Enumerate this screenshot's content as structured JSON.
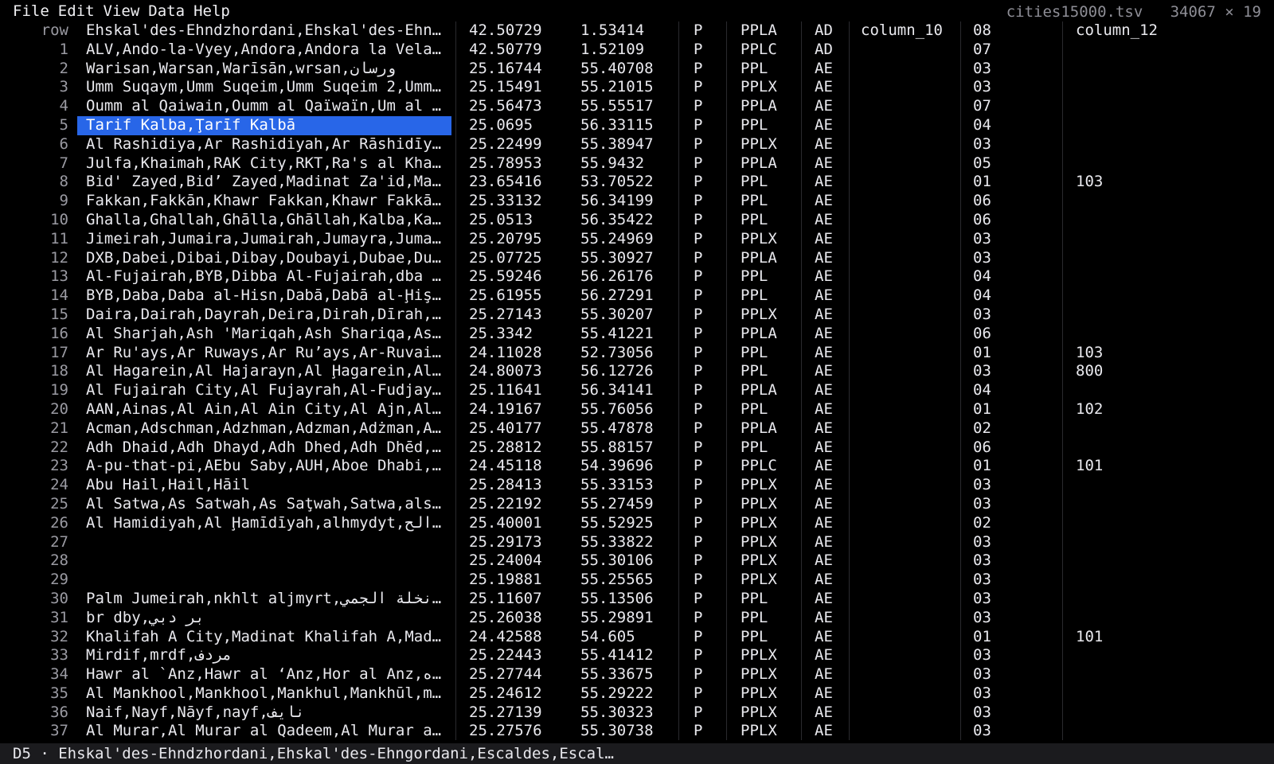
{
  "menu": [
    "File",
    "Edit",
    "View",
    "Data",
    "Help"
  ],
  "file_name": "cities15000.tsv",
  "dimensions": "34067 × 19",
  "header": {
    "row": "row",
    "name": "Ehskal'des-Ehndzhordani,Ehskal'des-Ehn…",
    "lat": "42.50729",
    "lon": "1.53414",
    "cls": "P",
    "code": "PPLA",
    "cc": "AD",
    "c10": "column_10",
    "adm": "08",
    "c12": "column_12"
  },
  "selected_row": 5,
  "rows": [
    {
      "n": "1",
      "name": "ALV,Ando-la-Vyey,Andora,Andora la Vela…",
      "lat": "42.50779",
      "lon": "1.52109",
      "cls": "P",
      "code": "PPLC",
      "cc": "AD",
      "adm": "07",
      "c12": ""
    },
    {
      "n": "2",
      "name": "Warisan,Warsan,Warīsān,wrsan,ورسان",
      "lat": "25.16744",
      "lon": "55.40708",
      "cls": "P",
      "code": "PPL",
      "cc": "AE",
      "adm": "03",
      "c12": ""
    },
    {
      "n": "3",
      "name": "Umm Suqaym,Umm Suqeim,Umm Suqeim 2,Umm…",
      "lat": "25.15491",
      "lon": "55.21015",
      "cls": "P",
      "code": "PPLX",
      "cc": "AE",
      "adm": "03",
      "c12": ""
    },
    {
      "n": "4",
      "name": "Oumm al Qaiwain,Oumm al Qaïwaïn,Um al …",
      "lat": "25.56473",
      "lon": "55.55517",
      "cls": "P",
      "code": "PPLA",
      "cc": "AE",
      "adm": "07",
      "c12": ""
    },
    {
      "n": "5",
      "name": "Tarif Kalba,Ţarīf Kalbā",
      "lat": "25.0695",
      "lon": "56.33115",
      "cls": "P",
      "code": "PPL",
      "cc": "AE",
      "adm": "04",
      "c12": ""
    },
    {
      "n": "6",
      "name": "Al Rashidiya,Ar Rashidiyah,Ar Rāshidīy…",
      "lat": "25.22499",
      "lon": "55.38947",
      "cls": "P",
      "code": "PPLX",
      "cc": "AE",
      "adm": "03",
      "c12": ""
    },
    {
      "n": "7",
      "name": "Julfa,Khaimah,RAK City,RKT,Ra's al Kha…",
      "lat": "25.78953",
      "lon": "55.9432",
      "cls": "P",
      "code": "PPLA",
      "cc": "AE",
      "adm": "05",
      "c12": ""
    },
    {
      "n": "8",
      "name": "Bid' Zayed,Bid’ Zayed,Madinat Za'id,Ma…",
      "lat": "23.65416",
      "lon": "53.70522",
      "cls": "P",
      "code": "PPL",
      "cc": "AE",
      "adm": "01",
      "c12": "103"
    },
    {
      "n": "9",
      "name": "Fakkan,Fakkān,Khawr Fakkan,Khawr Fakkā…",
      "lat": "25.33132",
      "lon": "56.34199",
      "cls": "P",
      "code": "PPL",
      "cc": "AE",
      "adm": "06",
      "c12": ""
    },
    {
      "n": "10",
      "name": "Ghalla,Ghallah,Ghālla,Ghāllah,Kalba,Ka…",
      "lat": "25.0513",
      "lon": "56.35422",
      "cls": "P",
      "code": "PPL",
      "cc": "AE",
      "adm": "06",
      "c12": ""
    },
    {
      "n": "11",
      "name": "Jimeirah,Jumaira,Jumairah,Jumayra,Juma…",
      "lat": "25.20795",
      "lon": "55.24969",
      "cls": "P",
      "code": "PPLX",
      "cc": "AE",
      "adm": "03",
      "c12": ""
    },
    {
      "n": "12",
      "name": "DXB,Dabei,Dibai,Dibay,Doubayi,Dubae,Du…",
      "lat": "25.07725",
      "lon": "55.30927",
      "cls": "P",
      "code": "PPLA",
      "cc": "AE",
      "adm": "03",
      "c12": ""
    },
    {
      "n": "13",
      "name": "Al-Fujairah,BYB,Dibba Al-Fujairah,dba …",
      "lat": "25.59246",
      "lon": "56.26176",
      "cls": "P",
      "code": "PPL",
      "cc": "AE",
      "adm": "04",
      "c12": ""
    },
    {
      "n": "14",
      "name": "BYB,Daba,Daba al-Hisn,Dabā,Dabā al-Ḩiş…",
      "lat": "25.61955",
      "lon": "56.27291",
      "cls": "P",
      "code": "PPL",
      "cc": "AE",
      "adm": "04",
      "c12": ""
    },
    {
      "n": "15",
      "name": "Daira,Dairah,Dayrah,Deira,Dirah,Dīrah,…",
      "lat": "25.27143",
      "lon": "55.30207",
      "cls": "P",
      "code": "PPLX",
      "cc": "AE",
      "adm": "03",
      "c12": ""
    },
    {
      "n": "16",
      "name": "Al Sharjah,Ash 'Mariqah,Ash Shariqa,As…",
      "lat": "25.3342",
      "lon": "55.41221",
      "cls": "P",
      "code": "PPLA",
      "cc": "AE",
      "adm": "06",
      "c12": ""
    },
    {
      "n": "17",
      "name": "Ar Ru'ays,Ar Ruways,Ar Ru’ays,Ar-Ruvai…",
      "lat": "24.11028",
      "lon": "52.73056",
      "cls": "P",
      "code": "PPL",
      "cc": "AE",
      "adm": "01",
      "c12": "103"
    },
    {
      "n": "18",
      "name": "Al Hagarein,Al Hajarayn,Al Ḩagarein,Al…",
      "lat": "24.80073",
      "lon": "56.12726",
      "cls": "P",
      "code": "PPL",
      "cc": "AE",
      "adm": "03",
      "c12": "800"
    },
    {
      "n": "19",
      "name": "Al Fujairah City,Al Fujayrah,Al-Fudjay…",
      "lat": "25.11641",
      "lon": "56.34141",
      "cls": "P",
      "code": "PPLA",
      "cc": "AE",
      "adm": "04",
      "c12": ""
    },
    {
      "n": "20",
      "name": "AAN,Ainas,Al Ain,Al Ain City,Al Ajn,Al…",
      "lat": "24.19167",
      "lon": "55.76056",
      "cls": "P",
      "code": "PPL",
      "cc": "AE",
      "adm": "01",
      "c12": "102"
    },
    {
      "n": "21",
      "name": "Acman,Adschman,Adzhman,Adzman,Adżman,A…",
      "lat": "25.40177",
      "lon": "55.47878",
      "cls": "P",
      "code": "PPLA",
      "cc": "AE",
      "adm": "02",
      "c12": ""
    },
    {
      "n": "22",
      "name": "Adh Dhaid,Adh Dhayd,Adh Dhed,Adh Dhēd,…",
      "lat": "25.28812",
      "lon": "55.88157",
      "cls": "P",
      "code": "PPL",
      "cc": "AE",
      "adm": "06",
      "c12": ""
    },
    {
      "n": "23",
      "name": "A-pu-that-pi,AEbu Saby,AUH,Aboe Dhabi,…",
      "lat": "24.45118",
      "lon": "54.39696",
      "cls": "P",
      "code": "PPLC",
      "cc": "AE",
      "adm": "01",
      "c12": "101"
    },
    {
      "n": "24",
      "name": "Abu Hail,Hail,Hāil",
      "lat": "25.28413",
      "lon": "55.33153",
      "cls": "P",
      "code": "PPLX",
      "cc": "AE",
      "adm": "03",
      "c12": ""
    },
    {
      "n": "25",
      "name": "Al Satwa,As Satwah,As Saţwah,Satwa,als…",
      "lat": "25.22192",
      "lon": "55.27459",
      "cls": "P",
      "code": "PPLX",
      "cc": "AE",
      "adm": "03",
      "c12": ""
    },
    {
      "n": "26",
      "name": "Al Hamidiyah,Al Ḩamīdīyah,alhmydyt,الح…",
      "lat": "25.40001",
      "lon": "55.52925",
      "cls": "P",
      "code": "PPLX",
      "cc": "AE",
      "adm": "02",
      "c12": ""
    },
    {
      "n": "27",
      "name": "",
      "lat": "25.29173",
      "lon": "55.33822",
      "cls": "P",
      "code": "PPLX",
      "cc": "AE",
      "adm": "03",
      "c12": ""
    },
    {
      "n": "28",
      "name": "",
      "lat": "25.24004",
      "lon": "55.30106",
      "cls": "P",
      "code": "PPLX",
      "cc": "AE",
      "adm": "03",
      "c12": ""
    },
    {
      "n": "29",
      "name": "",
      "lat": "25.19881",
      "lon": "55.25565",
      "cls": "P",
      "code": "PPLX",
      "cc": "AE",
      "adm": "03",
      "c12": ""
    },
    {
      "n": "30",
      "name": "Palm Jumeirah,nkhlt aljmyrt,نخلة الجمي…",
      "lat": "25.11607",
      "lon": "55.13506",
      "cls": "P",
      "code": "PPL",
      "cc": "AE",
      "adm": "03",
      "c12": ""
    },
    {
      "n": "31",
      "name": "br dby,بر دبي",
      "lat": "25.26038",
      "lon": "55.29891",
      "cls": "P",
      "code": "PPL",
      "cc": "AE",
      "adm": "03",
      "c12": ""
    },
    {
      "n": "32",
      "name": "Khalifah A City,Madinat Khalifah A,Mad…",
      "lat": "24.42588",
      "lon": "54.605",
      "cls": "P",
      "code": "PPL",
      "cc": "AE",
      "adm": "01",
      "c12": "101"
    },
    {
      "n": "33",
      "name": "Mirdif,mrdf,مردف",
      "lat": "25.22443",
      "lon": "55.41412",
      "cls": "P",
      "code": "PPLX",
      "cc": "AE",
      "adm": "03",
      "c12": ""
    },
    {
      "n": "34",
      "name": "Hawr al `Anz,Hawr al ‘Anz,Hor al Anz,ه…",
      "lat": "25.27744",
      "lon": "55.33675",
      "cls": "P",
      "code": "PPLX",
      "cc": "AE",
      "adm": "03",
      "c12": ""
    },
    {
      "n": "35",
      "name": "Al Mankhool,Mankhool,Mankhul,Mankhūl,m…",
      "lat": "25.24612",
      "lon": "55.29222",
      "cls": "P",
      "code": "PPLX",
      "cc": "AE",
      "adm": "03",
      "c12": ""
    },
    {
      "n": "36",
      "name": "Naif,Nayf,Nāyf,nayf,نايف",
      "lat": "25.27139",
      "lon": "55.30323",
      "cls": "P",
      "code": "PPLX",
      "cc": "AE",
      "adm": "03",
      "c12": ""
    },
    {
      "n": "37",
      "name": "Al Murar,Al Murar al Qadeem,Al Murar a…",
      "lat": "25.27576",
      "lon": "55.30738",
      "cls": "P",
      "code": "PPLX",
      "cc": "AE",
      "adm": "03",
      "c12": ""
    }
  ],
  "status": "D5 · Ehskal'des-Ehndzhordani,Ehskal'des-Ehngordani,Escaldes,Escal…"
}
